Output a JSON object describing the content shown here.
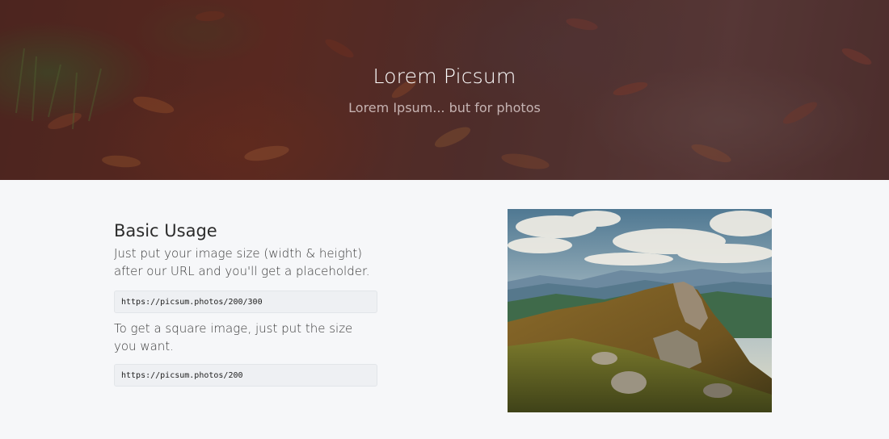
{
  "hero": {
    "title": "Lorem Picsum",
    "subtitle": "Lorem Ipsum... but for photos"
  },
  "basic_usage": {
    "heading": "Basic Usage",
    "intro": "Just put your image size (width & height) after our URL and you'll get a placeholder.",
    "example_url": "https://picsum.photos/200/300",
    "square_note": "To get a square image, just put the size you want.",
    "square_url": "https://picsum.photos/200"
  },
  "colors": {
    "page_background": "#f6f7f9",
    "code_background": "#eef0f3",
    "hero_tint": "#5b2e22"
  }
}
